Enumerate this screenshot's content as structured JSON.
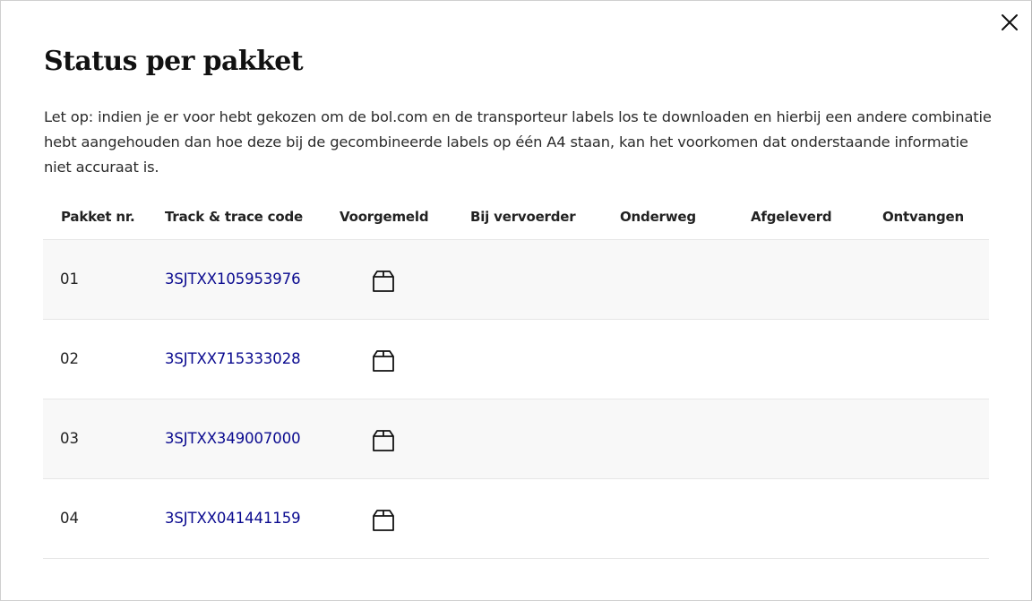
{
  "modal": {
    "title": "Status per pakket",
    "notice": "Let op: indien je er voor hebt gekozen om de bol.com en de transporteur labels los te downloaden en hierbij een andere combinatie hebt aangehouden dan hoe deze bij de gecombineerde labels op één A4 staan, kan het voorkomen dat onderstaande informatie niet accuraat is.",
    "close_icon": "close-icon"
  },
  "table": {
    "headers": {
      "nr": "Pakket nr.",
      "code": "Track & trace code",
      "voorgemeld": "Voorgemeld",
      "vervoerder": "Bij vervoerder",
      "onderweg": "Onderweg",
      "afgeleverd": "Afgeleverd",
      "ontvangen": "Ontvangen"
    },
    "rows": [
      {
        "nr": "01",
        "code": "3SJTXX105953976",
        "status_icon": "package-icon",
        "status": "Voorgemeld"
      },
      {
        "nr": "02",
        "code": "3SJTXX715333028",
        "status_icon": "package-icon",
        "status": "Voorgemeld"
      },
      {
        "nr": "03",
        "code": "3SJTXX349007000",
        "status_icon": "package-icon",
        "status": "Voorgemeld"
      },
      {
        "nr": "04",
        "code": "3SJTXX041441159",
        "status_icon": "package-icon",
        "status": "Voorgemeld"
      }
    ]
  },
  "colors": {
    "link": "#0a0a8f",
    "row_shade": "#f8f8f8",
    "divider": "#e6e6e6"
  }
}
